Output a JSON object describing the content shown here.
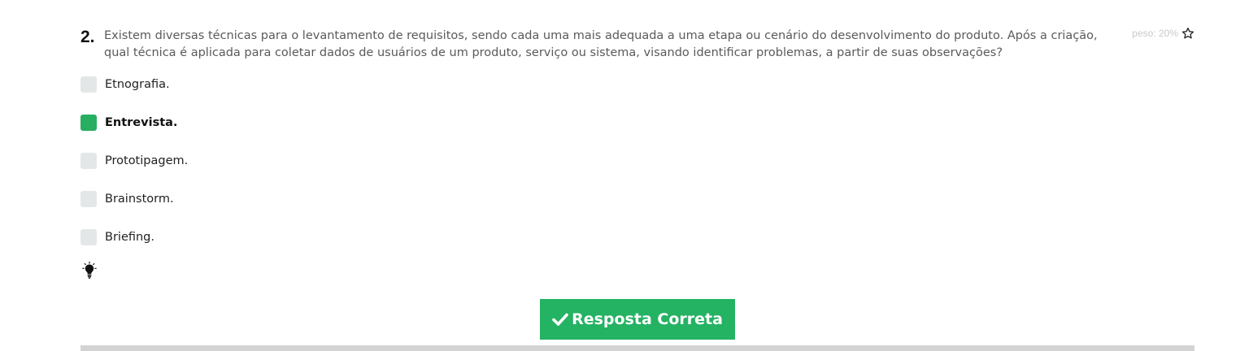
{
  "question": {
    "number": "2.",
    "text": "Existem diversas técnicas para o levantamento de requisitos, sendo cada uma mais adequada a uma etapa ou cenário do desenvolvimento do produto. Após a criação, qual técnica é aplicada para coletar dados de usuários de um produto, serviço ou sistema, visando identificar problemas, a partir de suas observações?",
    "weight": "peso: 20%",
    "star_icon": "star-outline-icon"
  },
  "options": [
    {
      "label": "Etnografia.",
      "selected": false
    },
    {
      "label": "Entrevista.",
      "selected": true
    },
    {
      "label": "Prototipagem.",
      "selected": false
    },
    {
      "label": "Brainstorm.",
      "selected": false
    },
    {
      "label": "Briefing.",
      "selected": false
    }
  ],
  "hint": {
    "icon": "lightbulb-icon"
  },
  "submit": {
    "label": "Resposta Correta",
    "icon": "check-icon",
    "color": "#24b263"
  },
  "colors": {
    "selected": "#27ae60",
    "unselected": "#e4e7e8",
    "divider": "#d3d3d3"
  }
}
